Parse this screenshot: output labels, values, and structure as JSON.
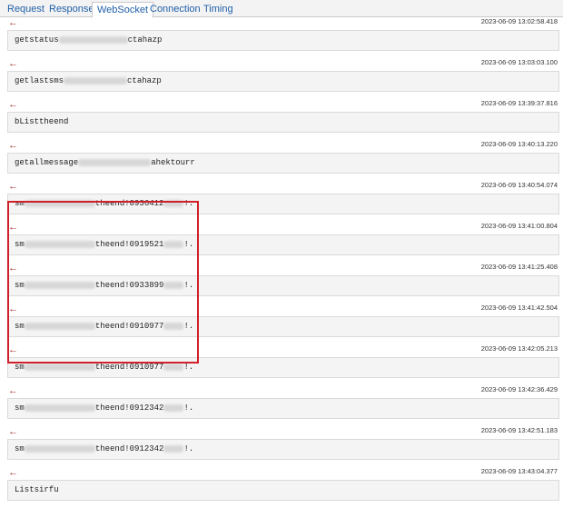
{
  "tabs": [
    {
      "label": "Request"
    },
    {
      "label": "Response"
    },
    {
      "label": "WebSocket"
    },
    {
      "label": "Connection"
    },
    {
      "label": "Timing"
    }
  ],
  "active_tab": "WebSocket",
  "messages": [
    {
      "timestamp": "2023-06-09 13:02:58.418",
      "prefix": "getstatus",
      "suffix": "ctahazp"
    },
    {
      "timestamp": "2023-06-09 13:03:03.100",
      "prefix": "getlastsms",
      "suffix": "ctahazp"
    },
    {
      "timestamp": "2023-06-09 13:39:37.816",
      "prefix": "bListtheend",
      "suffix": ""
    },
    {
      "timestamp": "2023-06-09 13:40:13.220",
      "prefix": "getallmessage",
      "suffix": "ahektourr"
    },
    {
      "timestamp": "2023-06-09 13:40:54.074",
      "prefix": "sm",
      "suffix": "theend!0936412",
      "tail": "!."
    },
    {
      "timestamp": "2023-06-09 13:41:00.804",
      "prefix": "sm",
      "suffix": "theend!0919521",
      "tail": "!."
    },
    {
      "timestamp": "2023-06-09 13:41:25.408",
      "prefix": "sm",
      "suffix": "theend!0933899",
      "tail": "!."
    },
    {
      "timestamp": "2023-06-09 13:41:42.504",
      "prefix": "sm",
      "suffix": "theend!0910977",
      "tail": "!."
    },
    {
      "timestamp": "2023-06-09 13:42:05.213",
      "prefix": "sm",
      "suffix": "theend!0910977",
      "tail": "!."
    },
    {
      "timestamp": "2023-06-09 13:42:36.429",
      "prefix": "sm",
      "suffix": "theend!0912342",
      "tail": "!."
    },
    {
      "timestamp": "2023-06-09 13:42:51.183",
      "prefix": "sm",
      "suffix": "theend!0912342",
      "tail": "!."
    },
    {
      "timestamp": "2023-06-09 13:43:04.377",
      "prefix": "Listsirfu",
      "suffix": ""
    }
  ],
  "icons": {
    "direction": "left-arrow-icon"
  },
  "colors": {
    "arrow": "#a0302a",
    "highlight": "#d0202a",
    "tab_text": "#1f5fa8"
  }
}
